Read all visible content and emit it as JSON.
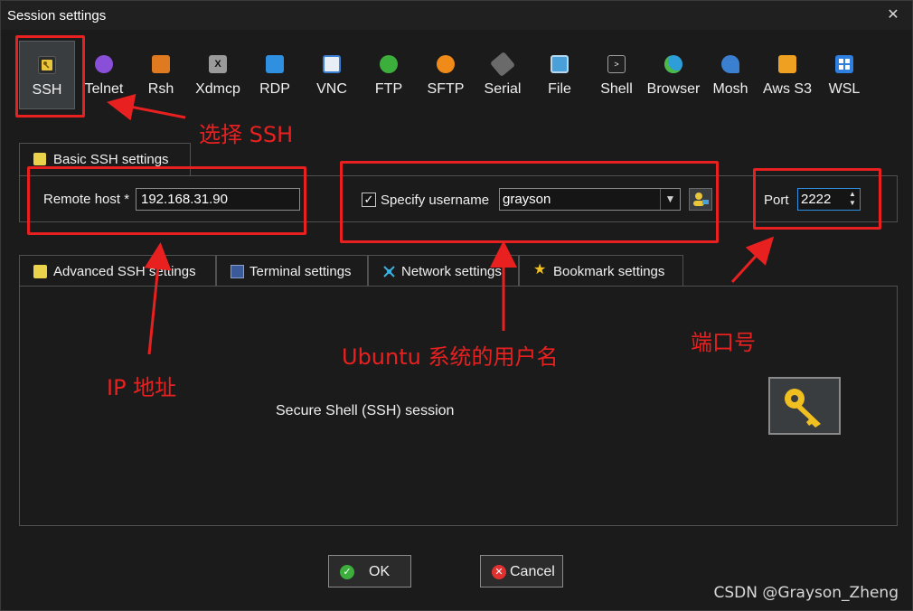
{
  "window": {
    "title": "Session settings",
    "close_glyph": "✕"
  },
  "toolbar": {
    "items": [
      {
        "label": "SSH",
        "icon": "key-icon",
        "color": "#e8c53a",
        "selected": true
      },
      {
        "label": "Telnet",
        "icon": "telnet-icon",
        "color": "#8a4fd8"
      },
      {
        "label": "Rsh",
        "icon": "rsh-icon",
        "color": "#e07a20"
      },
      {
        "label": "Xdmcp",
        "icon": "xdmcp-icon",
        "color": "#9a9a9a"
      },
      {
        "label": "RDP",
        "icon": "rdp-icon",
        "color": "#2f8fe0"
      },
      {
        "label": "VNC",
        "icon": "vnc-icon",
        "color": "#3a7fd0"
      },
      {
        "label": "FTP",
        "icon": "ftp-icon",
        "color": "#3cae3c"
      },
      {
        "label": "SFTP",
        "icon": "sftp-icon",
        "color": "#f08a18"
      },
      {
        "label": "Serial",
        "icon": "serial-icon",
        "color": "#b0b0b0"
      },
      {
        "label": "File",
        "icon": "file-icon",
        "color": "#4aa0d8"
      },
      {
        "label": "Shell",
        "icon": "shell-icon",
        "color": "#303030"
      },
      {
        "label": "Browser",
        "icon": "browser-icon",
        "color": "#2e9ed8"
      },
      {
        "label": "Mosh",
        "icon": "mosh-icon",
        "color": "#3a7fd0"
      },
      {
        "label": "Aws S3",
        "icon": "aws-s3-icon",
        "color": "#f0a020"
      },
      {
        "label": "WSL",
        "icon": "wsl-icon",
        "color": "#2f7fe0"
      }
    ]
  },
  "basic": {
    "tab_label": "Basic SSH settings",
    "remote_host_label": "Remote host *",
    "remote_host_value": "192.168.31.90",
    "specify_username_label": "Specify username",
    "username_checked_glyph": "✓",
    "username_value": "grayson",
    "port_label": "Port",
    "port_value": "2222"
  },
  "tabs": [
    {
      "label": "Advanced SSH settings",
      "icon": "key-icon"
    },
    {
      "label": "Terminal settings",
      "icon": "terminal-icon"
    },
    {
      "label": "Network settings",
      "icon": "network-icon"
    },
    {
      "label": "Bookmark settings",
      "icon": "star-icon"
    }
  ],
  "content": {
    "description": "Secure Shell (SSH) session"
  },
  "buttons": {
    "ok_label": "OK",
    "cancel_label": "Cancel",
    "ok_glyph": "✓",
    "cancel_glyph": "✕"
  },
  "annotations": {
    "select_ssh": "选择 SSH",
    "ip_address": "IP 地址",
    "ubuntu_username": "Ubuntu 系统的用户名",
    "port_number": "端口号",
    "accent_color": "#e82020"
  },
  "watermark": "CSDN @Grayson_Zheng"
}
